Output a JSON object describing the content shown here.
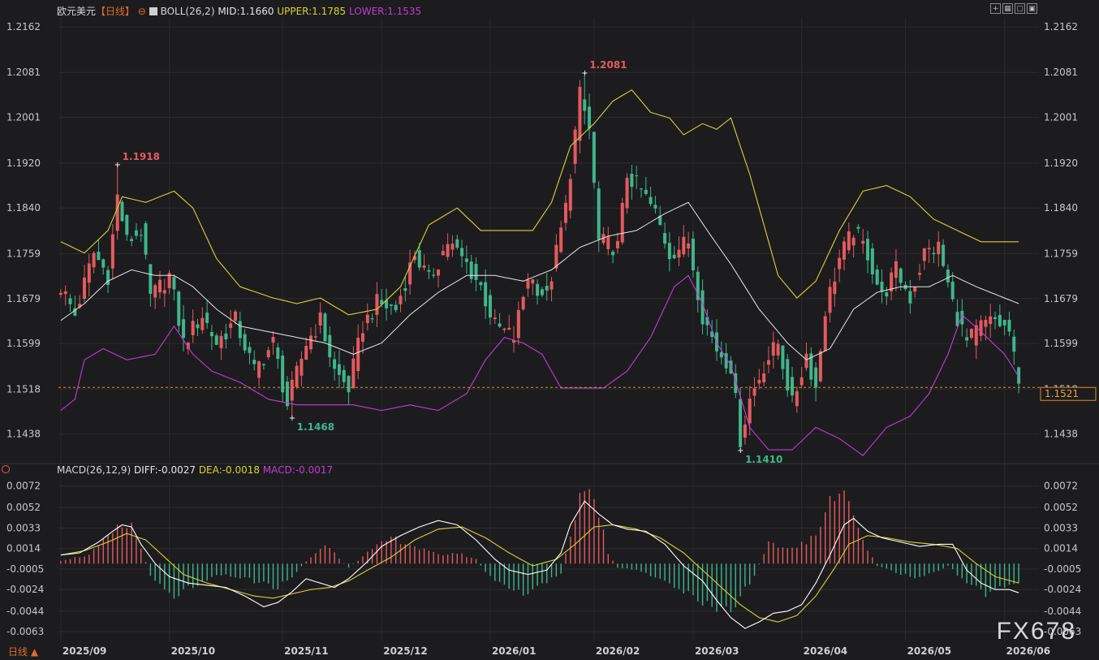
{
  "header": {
    "symbol": "欧元美元",
    "period_badge": "【日线】",
    "boll_name": "BOLL(26,2)",
    "boll_mid": "MID:1.1660",
    "boll_upper": "UPPER:1.1785",
    "boll_lower": "LOWER:1.1535",
    "macd_name": "MACD(26,12,9)",
    "macd_diff": "DIFF:-0.0027",
    "macd_dea": "DEA:-0.0018",
    "macd_val": "MACD:-0.0017"
  },
  "toolbar": [
    "crosshair-icon",
    "layout-icon",
    "expand-icon",
    "window-icon"
  ],
  "period_selector": "日线 ▲",
  "watermark": "FX678",
  "colors": {
    "up": "#e45a5f",
    "down": "#3fb68b",
    "upper": "#d7d23a",
    "mid": "#e6e6e6",
    "lower": "#c23bd4",
    "dea": "#d7d23a",
    "diff": "#ffffff",
    "price_line": "#e08a2a"
  },
  "chart_data": {
    "type": "candlestick",
    "price_axis": {
      "ylim": [
        1.139,
        1.2178
      ],
      "ticks": [
        "1.2162",
        "1.2081",
        "1.2001",
        "1.1920",
        "1.1840",
        "1.1759",
        "1.1679",
        "1.1599",
        "1.1518",
        "1.1438"
      ]
    },
    "macd_axis": {
      "ylim": [
        -0.0072,
        0.008
      ],
      "ticks": [
        "0.0072",
        "0.0052",
        "0.0033",
        "0.0014",
        "-0.0005",
        "-0.0024",
        "-0.0044",
        "-0.0063"
      ]
    },
    "x_labels": [
      "2025/09",
      "2025/10",
      "2025/11",
      "2025/12",
      "2026/01",
      "2026/02",
      "2026/03",
      "2026/04",
      "2026/05",
      "2026/06"
    ],
    "x_label_positions": [
      0,
      23,
      47,
      68,
      91,
      113,
      134,
      157,
      179,
      200
    ],
    "last_price": "1.1521",
    "markers": [
      {
        "label": "1.1918",
        "index": 12,
        "value": 1.1918,
        "pos": "high"
      },
      {
        "label": "1.1468",
        "index": 49,
        "value": 1.1468,
        "pos": "low"
      },
      {
        "label": "1.2081",
        "index": 111,
        "value": 1.2081,
        "pos": "high"
      },
      {
        "label": "1.1410",
        "index": 144,
        "value": 1.141,
        "pos": "low"
      }
    ],
    "close_anchors": [
      [
        0,
        1.17
      ],
      [
        3,
        1.165
      ],
      [
        7,
        1.176
      ],
      [
        10,
        1.172
      ],
      [
        12,
        1.186
      ],
      [
        14,
        1.178
      ],
      [
        17,
        1.18
      ],
      [
        19,
        1.168
      ],
      [
        23,
        1.172
      ],
      [
        26,
        1.16
      ],
      [
        30,
        1.165
      ],
      [
        33,
        1.16
      ],
      [
        37,
        1.164
      ],
      [
        41,
        1.155
      ],
      [
        45,
        1.16
      ],
      [
        48,
        1.149
      ],
      [
        52,
        1.16
      ],
      [
        55,
        1.164
      ],
      [
        58,
        1.155
      ],
      [
        61,
        1.152
      ],
      [
        64,
        1.163
      ],
      [
        67,
        1.167
      ],
      [
        71,
        1.166
      ],
      [
        75,
        1.176
      ],
      [
        78,
        1.171
      ],
      [
        82,
        1.178
      ],
      [
        86,
        1.174
      ],
      [
        89,
        1.17
      ],
      [
        92,
        1.163
      ],
      [
        96,
        1.161
      ],
      [
        99,
        1.172
      ],
      [
        103,
        1.168
      ],
      [
        107,
        1.184
      ],
      [
        110,
        1.204
      ],
      [
        112,
        1.198
      ],
      [
        114,
        1.178
      ],
      [
        118,
        1.177
      ],
      [
        120,
        1.19
      ],
      [
        123,
        1.187
      ],
      [
        126,
        1.183
      ],
      [
        129,
        1.176
      ],
      [
        133,
        1.178
      ],
      [
        136,
        1.165
      ],
      [
        139,
        1.159
      ],
      [
        142,
        1.156
      ],
      [
        144,
        1.143
      ],
      [
        146,
        1.15
      ],
      [
        149,
        1.156
      ],
      [
        152,
        1.16
      ],
      [
        155,
        1.149
      ],
      [
        158,
        1.158
      ],
      [
        160,
        1.152
      ],
      [
        162,
        1.166
      ],
      [
        165,
        1.175
      ],
      [
        168,
        1.18
      ],
      [
        171,
        1.176
      ],
      [
        174,
        1.168
      ],
      [
        177,
        1.173
      ],
      [
        180,
        1.168
      ],
      [
        183,
        1.176
      ],
      [
        186,
        1.177
      ],
      [
        189,
        1.167
      ],
      [
        192,
        1.16
      ],
      [
        195,
        1.163
      ],
      [
        198,
        1.164
      ],
      [
        201,
        1.162
      ],
      [
        203,
        1.152
      ]
    ],
    "boll_upper_anchors": [
      [
        0,
        1.178
      ],
      [
        5,
        1.176
      ],
      [
        10,
        1.18
      ],
      [
        13,
        1.186
      ],
      [
        18,
        1.185
      ],
      [
        24,
        1.187
      ],
      [
        28,
        1.184
      ],
      [
        33,
        1.175
      ],
      [
        38,
        1.17
      ],
      [
        45,
        1.168
      ],
      [
        50,
        1.167
      ],
      [
        55,
        1.168
      ],
      [
        61,
        1.165
      ],
      [
        67,
        1.166
      ],
      [
        72,
        1.17
      ],
      [
        78,
        1.181
      ],
      [
        84,
        1.184
      ],
      [
        89,
        1.18
      ],
      [
        94,
        1.18
      ],
      [
        100,
        1.18
      ],
      [
        104,
        1.185
      ],
      [
        108,
        1.195
      ],
      [
        113,
        1.199
      ],
      [
        117,
        1.203
      ],
      [
        121,
        1.205
      ],
      [
        125,
        1.201
      ],
      [
        129,
        1.2
      ],
      [
        132,
        1.197
      ],
      [
        136,
        1.199
      ],
      [
        139,
        1.198
      ],
      [
        142,
        1.2
      ],
      [
        146,
        1.19
      ],
      [
        152,
        1.172
      ],
      [
        156,
        1.168
      ],
      [
        160,
        1.171
      ],
      [
        165,
        1.18
      ],
      [
        170,
        1.187
      ],
      [
        175,
        1.188
      ],
      [
        180,
        1.186
      ],
      [
        185,
        1.182
      ],
      [
        190,
        1.18
      ],
      [
        195,
        1.178
      ],
      [
        200,
        1.178
      ],
      [
        203,
        1.178
      ]
    ],
    "boll_mid_anchors": [
      [
        0,
        1.164
      ],
      [
        5,
        1.167
      ],
      [
        10,
        1.171
      ],
      [
        15,
        1.173
      ],
      [
        20,
        1.172
      ],
      [
        24,
        1.172
      ],
      [
        28,
        1.17
      ],
      [
        33,
        1.166
      ],
      [
        38,
        1.163
      ],
      [
        44,
        1.162
      ],
      [
        50,
        1.161
      ],
      [
        56,
        1.16
      ],
      [
        62,
        1.158
      ],
      [
        68,
        1.16
      ],
      [
        74,
        1.165
      ],
      [
        80,
        1.169
      ],
      [
        86,
        1.172
      ],
      [
        92,
        1.172
      ],
      [
        98,
        1.171
      ],
      [
        104,
        1.173
      ],
      [
        110,
        1.177
      ],
      [
        116,
        1.179
      ],
      [
        122,
        1.18
      ],
      [
        128,
        1.183
      ],
      [
        133,
        1.185
      ],
      [
        137,
        1.18
      ],
      [
        142,
        1.174
      ],
      [
        148,
        1.166
      ],
      [
        154,
        1.16
      ],
      [
        158,
        1.157
      ],
      [
        163,
        1.159
      ],
      [
        168,
        1.166
      ],
      [
        173,
        1.169
      ],
      [
        178,
        1.17
      ],
      [
        184,
        1.17
      ],
      [
        189,
        1.172
      ],
      [
        194,
        1.17
      ],
      [
        200,
        1.168
      ],
      [
        203,
        1.167
      ]
    ],
    "boll_lower_anchors": [
      [
        0,
        1.148
      ],
      [
        3,
        1.15
      ],
      [
        5,
        1.157
      ],
      [
        9,
        1.159
      ],
      [
        14,
        1.157
      ],
      [
        20,
        1.158
      ],
      [
        24,
        1.163
      ],
      [
        28,
        1.158
      ],
      [
        32,
        1.155
      ],
      [
        38,
        1.153
      ],
      [
        44,
        1.15
      ],
      [
        50,
        1.149
      ],
      [
        56,
        1.149
      ],
      [
        62,
        1.149
      ],
      [
        68,
        1.148
      ],
      [
        74,
        1.149
      ],
      [
        80,
        1.148
      ],
      [
        86,
        1.151
      ],
      [
        90,
        1.157
      ],
      [
        94,
        1.161
      ],
      [
        98,
        1.16
      ],
      [
        102,
        1.158
      ],
      [
        106,
        1.152
      ],
      [
        110,
        1.152
      ],
      [
        115,
        1.152
      ],
      [
        120,
        1.155
      ],
      [
        125,
        1.161
      ],
      [
        130,
        1.17
      ],
      [
        133,
        1.172
      ],
      [
        136,
        1.167
      ],
      [
        139,
        1.16
      ],
      [
        142,
        1.156
      ],
      [
        146,
        1.145
      ],
      [
        150,
        1.141
      ],
      [
        155,
        1.141
      ],
      [
        160,
        1.145
      ],
      [
        165,
        1.143
      ],
      [
        170,
        1.14
      ],
      [
        175,
        1.145
      ],
      [
        180,
        1.147
      ],
      [
        184,
        1.151
      ],
      [
        188,
        1.158
      ],
      [
        191,
        1.165
      ],
      [
        195,
        1.162
      ],
      [
        200,
        1.158
      ],
      [
        203,
        1.154
      ]
    ],
    "macd_hist_anchors": [
      [
        0,
        0.0003
      ],
      [
        6,
        0.0008
      ],
      [
        12,
        0.0032
      ],
      [
        15,
        0.0036
      ],
      [
        17,
        0.0014
      ],
      [
        19,
        -0.001
      ],
      [
        24,
        -0.003
      ],
      [
        28,
        -0.002
      ],
      [
        33,
        -0.001
      ],
      [
        38,
        -0.0012
      ],
      [
        42,
        -0.0018
      ],
      [
        46,
        -0.0022
      ],
      [
        48,
        -0.0016
      ],
      [
        52,
        0.0002
      ],
      [
        56,
        0.0018
      ],
      [
        58,
        0.001
      ],
      [
        61,
        -0.0004
      ],
      [
        65,
        0.001
      ],
      [
        70,
        0.0024
      ],
      [
        73,
        0.002
      ],
      [
        76,
        0.0014
      ],
      [
        80,
        0.0008
      ],
      [
        84,
        0.001
      ],
      [
        88,
        0.0004
      ],
      [
        90,
        -0.0008
      ],
      [
        94,
        -0.0022
      ],
      [
        98,
        -0.0028
      ],
      [
        102,
        -0.0018
      ],
      [
        106,
        -0.001
      ],
      [
        109,
        0.0046
      ],
      [
        111,
        0.0076
      ],
      [
        114,
        0.0048
      ],
      [
        116,
        0.001
      ],
      [
        118,
        -0.0004
      ],
      [
        122,
        -0.0006
      ],
      [
        126,
        -0.0012
      ],
      [
        130,
        -0.0022
      ],
      [
        134,
        -0.0032
      ],
      [
        138,
        -0.004
      ],
      [
        142,
        -0.0046
      ],
      [
        144,
        -0.0032
      ],
      [
        147,
        -0.001
      ],
      [
        150,
        0.0018
      ],
      [
        154,
        0.0014
      ],
      [
        158,
        0.002
      ],
      [
        161,
        0.003
      ],
      [
        163,
        0.0062
      ],
      [
        165,
        0.0074
      ],
      [
        167,
        0.006
      ],
      [
        170,
        0.002
      ],
      [
        173,
        -0.0002
      ],
      [
        177,
        -0.0008
      ],
      [
        181,
        -0.0014
      ],
      [
        185,
        -0.0008
      ],
      [
        188,
        -0.0002
      ],
      [
        192,
        -0.0018
      ],
      [
        196,
        -0.003
      ],
      [
        200,
        -0.002
      ],
      [
        203,
        -0.0017
      ]
    ],
    "macd_diff_anchors": [
      [
        0,
        0.0008
      ],
      [
        4,
        0.001
      ],
      [
        8,
        0.002
      ],
      [
        11,
        0.003
      ],
      [
        13,
        0.0036
      ],
      [
        15,
        0.0034
      ],
      [
        17,
        0.0018
      ],
      [
        20,
        0.0
      ],
      [
        23,
        -0.0012
      ],
      [
        27,
        -0.0018
      ],
      [
        31,
        -0.002
      ],
      [
        35,
        -0.0022
      ],
      [
        39,
        -0.003
      ],
      [
        43,
        -0.004
      ],
      [
        46,
        -0.0036
      ],
      [
        49,
        -0.0026
      ],
      [
        52,
        -0.0014
      ],
      [
        55,
        -0.0018
      ],
      [
        58,
        -0.0022
      ],
      [
        61,
        -0.0014
      ],
      [
        65,
        0.0002
      ],
      [
        68,
        0.0016
      ],
      [
        72,
        0.0026
      ],
      [
        76,
        0.0034
      ],
      [
        80,
        0.004
      ],
      [
        84,
        0.0036
      ],
      [
        88,
        0.0022
      ],
      [
        92,
        0.0004
      ],
      [
        95,
        -0.0006
      ],
      [
        99,
        -0.001
      ],
      [
        103,
        -0.0006
      ],
      [
        106,
        0.001
      ],
      [
        108,
        0.0036
      ],
      [
        111,
        0.0058
      ],
      [
        114,
        0.0046
      ],
      [
        117,
        0.0036
      ],
      [
        120,
        0.0032
      ],
      [
        124,
        0.003
      ],
      [
        128,
        0.0018
      ],
      [
        132,
        -0.0002
      ],
      [
        136,
        -0.0016
      ],
      [
        139,
        -0.0034
      ],
      [
        142,
        -0.005
      ],
      [
        145,
        -0.006
      ],
      [
        148,
        -0.0054
      ],
      [
        151,
        -0.0046
      ],
      [
        154,
        -0.0044
      ],
      [
        157,
        -0.0038
      ],
      [
        160,
        -0.0018
      ],
      [
        163,
        0.0008
      ],
      [
        166,
        0.0036
      ],
      [
        168,
        0.0042
      ],
      [
        171,
        0.003
      ],
      [
        174,
        0.0024
      ],
      [
        178,
        0.002
      ],
      [
        182,
        0.0016
      ],
      [
        186,
        0.0018
      ],
      [
        189,
        0.0018
      ],
      [
        192,
        -0.0006
      ],
      [
        195,
        -0.0018
      ],
      [
        198,
        -0.0024
      ],
      [
        201,
        -0.0024
      ],
      [
        203,
        -0.0027
      ]
    ],
    "macd_dea_anchors": [
      [
        0,
        0.0008
      ],
      [
        5,
        0.0012
      ],
      [
        10,
        0.002
      ],
      [
        14,
        0.0028
      ],
      [
        18,
        0.0022
      ],
      [
        22,
        0.0006
      ],
      [
        26,
        -0.001
      ],
      [
        31,
        -0.0018
      ],
      [
        36,
        -0.0024
      ],
      [
        41,
        -0.003
      ],
      [
        45,
        -0.0032
      ],
      [
        49,
        -0.0028
      ],
      [
        53,
        -0.0024
      ],
      [
        57,
        -0.0022
      ],
      [
        61,
        -0.0016
      ],
      [
        65,
        -0.0006
      ],
      [
        70,
        0.0006
      ],
      [
        75,
        0.0022
      ],
      [
        80,
        0.0032
      ],
      [
        85,
        0.0034
      ],
      [
        90,
        0.0024
      ],
      [
        95,
        0.001
      ],
      [
        100,
        -0.0002
      ],
      [
        105,
        0.0004
      ],
      [
        109,
        0.0018
      ],
      [
        113,
        0.0034
      ],
      [
        117,
        0.0036
      ],
      [
        122,
        0.0032
      ],
      [
        127,
        0.0024
      ],
      [
        132,
        0.001
      ],
      [
        136,
        -0.0006
      ],
      [
        140,
        -0.0022
      ],
      [
        144,
        -0.0038
      ],
      [
        148,
        -0.005
      ],
      [
        152,
        -0.0054
      ],
      [
        156,
        -0.0048
      ],
      [
        160,
        -0.003
      ],
      [
        164,
        -0.0004
      ],
      [
        167,
        0.0018
      ],
      [
        171,
        0.0026
      ],
      [
        175,
        0.0024
      ],
      [
        180,
        0.002
      ],
      [
        185,
        0.0018
      ],
      [
        190,
        0.0014
      ],
      [
        194,
        0.0
      ],
      [
        198,
        -0.0012
      ],
      [
        203,
        -0.0018
      ]
    ]
  }
}
